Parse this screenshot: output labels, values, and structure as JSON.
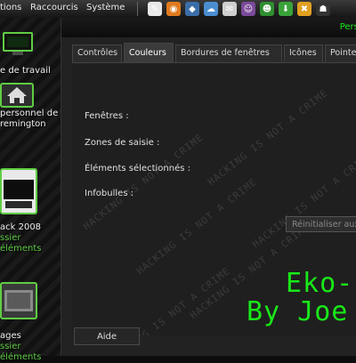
{
  "panel": {
    "menu_apps": "tions",
    "menu_shortcuts": "Raccourcis",
    "menu_system": "Système",
    "launchers": [
      {
        "icon": "text-editor-icon",
        "glyph": "✎",
        "bg": "#e8e8e8"
      },
      {
        "icon": "firefox-icon",
        "glyph": "◉",
        "bg": "#e07a1e"
      },
      {
        "icon": "thunderbird-icon",
        "glyph": "◆",
        "bg": "#3b6ea8"
      },
      {
        "icon": "cloud-icon",
        "glyph": "☁",
        "bg": "#4a8ed0"
      },
      {
        "icon": "mail-icon",
        "glyph": "✉",
        "bg": "#cfcfcf"
      },
      {
        "icon": "ghost-icon",
        "glyph": "☺",
        "bg": "#7a4a9a"
      },
      {
        "icon": "chat-icon",
        "glyph": "☻",
        "bg": "#2f8f2f"
      },
      {
        "icon": "download-icon",
        "glyph": "⬇",
        "bg": "#3aa33a"
      },
      {
        "icon": "tools-icon",
        "glyph": "✖",
        "bg": "#e0a020"
      },
      {
        "icon": "invader-icon",
        "glyph": "☗",
        "bg": "#333"
      }
    ]
  },
  "desktop": {
    "items": [
      {
        "lines": [
          "e de travail"
        ]
      },
      {
        "lines": [
          "personnel de",
          "remington"
        ]
      },
      {
        "lines": [
          "ack 2008"
        ],
        "sub": [
          "ssier",
          "éléments"
        ]
      },
      {
        "lines": [
          "ages"
        ],
        "sub": [
          "ssier",
          "éléments"
        ]
      }
    ]
  },
  "window": {
    "title_right": "Perso",
    "tabs": [
      "Contrôles",
      "Couleurs",
      "Bordures de fenêtres",
      "Icônes",
      "Pointe"
    ],
    "active_tab": 1,
    "fields": {
      "windows": "Fenêtres :",
      "input_zones": "Zones de saisie :",
      "selected_items": "Éléments sélectionnés :",
      "tooltips": "Infobulles :"
    },
    "reset_button": "Réinitialiser aux",
    "watermark": "HACKING IS NOT A CRIME",
    "overlay_line1": "Eko-",
    "overlay_line2": "By Joe",
    "help_button": "Aide"
  },
  "colors": {
    "accent_green": "#19e819",
    "label_green": "#5fcd43"
  }
}
